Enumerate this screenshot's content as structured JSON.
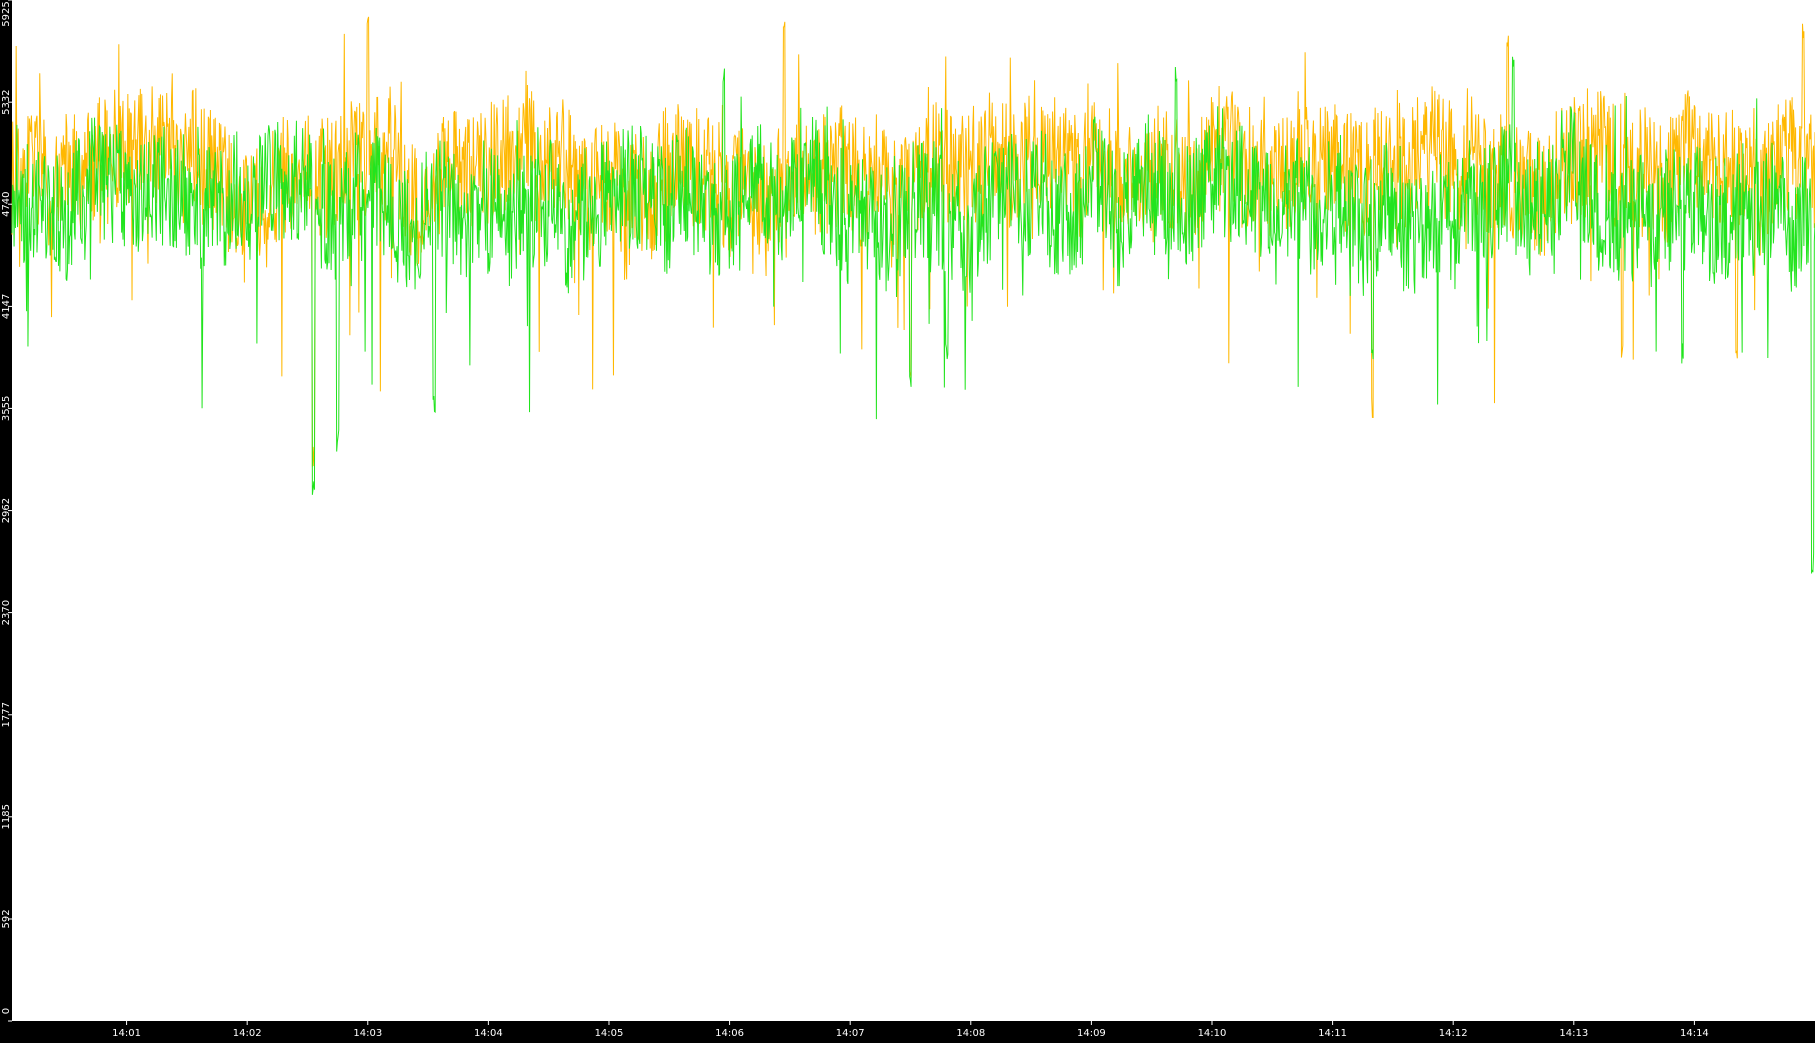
{
  "chart_data": {
    "type": "line",
    "title": "",
    "xlabel": "",
    "ylabel": "",
    "ylim": [
      0,
      5925
    ],
    "y_ticks": [
      0,
      592,
      1185,
      1777,
      2370,
      2962,
      3555,
      4147,
      4740,
      5332,
      5925
    ],
    "x_range_minutes": [
      840.05,
      855
    ],
    "x_ticks": [
      {
        "label": "14:01",
        "minutes": 841
      },
      {
        "label": "14:02",
        "minutes": 842
      },
      {
        "label": "14:03",
        "minutes": 843
      },
      {
        "label": "14:04",
        "minutes": 844
      },
      {
        "label": "14:05",
        "minutes": 845
      },
      {
        "label": "14:06",
        "minutes": 846
      },
      {
        "label": "14:07",
        "minutes": 847
      },
      {
        "label": "14:08",
        "minutes": 848
      },
      {
        "label": "14:09",
        "minutes": 849
      },
      {
        "label": "14:10",
        "minutes": 850
      },
      {
        "label": "14:11",
        "minutes": 851
      },
      {
        "label": "14:12",
        "minutes": 852
      },
      {
        "label": "14:13",
        "minutes": 853
      },
      {
        "label": "14:14",
        "minutes": 854
      }
    ],
    "grid": false,
    "background": "#ffffff",
    "axis_background": "#000000",
    "series": [
      {
        "color": "#ffb800",
        "band": [
          4500,
          5400
        ],
        "typical": 4950,
        "dips": [
          {
            "minutes": 842.55,
            "value": 3200
          },
          {
            "minutes": 847.5,
            "value": 3700
          },
          {
            "minutes": 851.33,
            "value": 3500
          },
          {
            "minutes": 853.4,
            "value": 3800
          },
          {
            "minutes": 854.35,
            "value": 3800
          }
        ],
        "peaks": [
          {
            "minutes": 843.0,
            "value": 5850
          },
          {
            "minutes": 846.45,
            "value": 5850
          },
          {
            "minutes": 852.45,
            "value": 5750
          },
          {
            "minutes": 854.9,
            "value": 5800
          }
        ]
      },
      {
        "color": "#22e41e",
        "band": [
          4300,
          5200
        ],
        "typical": 4750,
        "dips": [
          {
            "minutes": 842.55,
            "value": 3050
          },
          {
            "minutes": 842.75,
            "value": 3300
          },
          {
            "minutes": 843.55,
            "value": 3500
          },
          {
            "minutes": 847.5,
            "value": 3650
          },
          {
            "minutes": 847.8,
            "value": 3800
          },
          {
            "minutes": 851.33,
            "value": 3800
          },
          {
            "minutes": 853.9,
            "value": 3800
          },
          {
            "minutes": 854.98,
            "value": 2580
          }
        ],
        "peaks": [
          {
            "minutes": 845.95,
            "value": 5550
          },
          {
            "minutes": 849.7,
            "value": 5550
          },
          {
            "minutes": 852.5,
            "value": 5600
          }
        ]
      }
    ]
  }
}
